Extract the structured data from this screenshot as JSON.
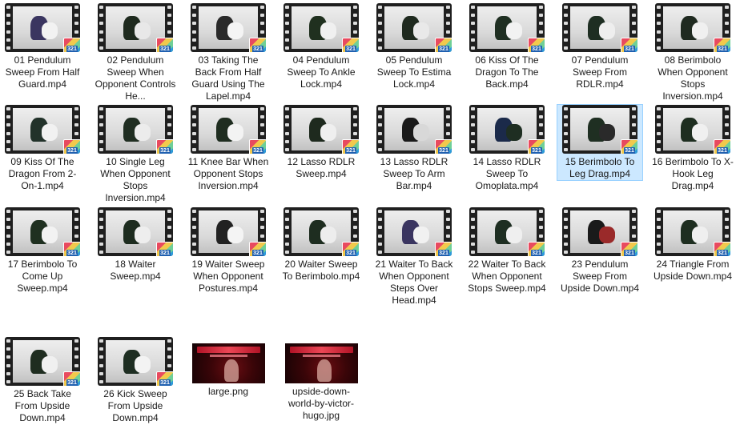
{
  "files": [
    {
      "name": "01 Pendulum Sweep From Half Guard.mp4",
      "type": "video",
      "tone": [
        "#3a3560",
        "#f2f2f2"
      ]
    },
    {
      "name": "02 Pendulum Sweep When Opponent Controls He...",
      "type": "video",
      "tone": [
        "#1e2a1e",
        "#e8e8e8"
      ]
    },
    {
      "name": "03 Taking The Back From Half Guard Using The Lapel.mp4",
      "type": "video",
      "tone": [
        "#2a2a2a",
        "#f4f4f4"
      ]
    },
    {
      "name": "04 Pendulum Sweep To Ankle Lock.mp4",
      "type": "video",
      "tone": [
        "#20301f",
        "#f0f0f0"
      ]
    },
    {
      "name": "05 Pendulum Sweep To Estima Lock.mp4",
      "type": "video",
      "tone": [
        "#1f2a1f",
        "#e9e9e9"
      ]
    },
    {
      "name": "06 Kiss Of The Dragon To The Back.mp4",
      "type": "video",
      "tone": [
        "#1f2f22",
        "#f2f2f2"
      ]
    },
    {
      "name": "07 Pendulum Sweep From RDLR.mp4",
      "type": "video",
      "tone": [
        "#1e2e22",
        "#eeeeee"
      ]
    },
    {
      "name": "08 Berimbolo When Opponent Stops Inversion.mp4",
      "type": "video",
      "tone": [
        "#1f2a20",
        "#f0f0f0"
      ]
    },
    {
      "name": "09 Kiss Of The Dragon From 2-On-1.mp4",
      "type": "video",
      "tone": [
        "#22322a",
        "#f1f1f1"
      ]
    },
    {
      "name": "10 Single Leg When Opponent Stops Inversion.mp4",
      "type": "video",
      "tone": [
        "#202e22",
        "#ececec"
      ]
    },
    {
      "name": "11 Knee Bar When Opponent Stops Inversion.mp4",
      "type": "video",
      "tone": [
        "#1f2d20",
        "#f3f3f3"
      ]
    },
    {
      "name": "12 Lasso RDLR Sweep.mp4",
      "type": "video",
      "tone": [
        "#1e2a1e",
        "#efefef"
      ]
    },
    {
      "name": "13 Lasso RDLR Sweep To Arm Bar.mp4",
      "type": "video",
      "tone": [
        "#1a1a1a",
        "#d8d8d8"
      ]
    },
    {
      "name": "14 Lasso RDLR Sweep To Omoplata.mp4",
      "type": "video",
      "tone": [
        "#1b2a4a",
        "#1e2e22"
      ]
    },
    {
      "name": "15 Berimbolo To Leg Drag.mp4",
      "type": "video",
      "tone": [
        "#1f2f22",
        "#2a2a2a"
      ],
      "selected": true
    },
    {
      "name": "16 Berimbolo To X-Hook Leg Drag.mp4",
      "type": "video",
      "tone": [
        "#1e2e20",
        "#f0f0f0"
      ]
    },
    {
      "name": "17 Berimbolo To Come Up Sweep.mp4",
      "type": "video",
      "tone": [
        "#1f3020",
        "#f2f2f2"
      ]
    },
    {
      "name": "18 Waiter Sweep.mp4",
      "type": "video",
      "tone": [
        "#1d2c1f",
        "#eeeeee"
      ]
    },
    {
      "name": "19 Waiter Sweep When Opponent Postures.mp4",
      "type": "video",
      "tone": [
        "#222222",
        "#f4f4f4"
      ]
    },
    {
      "name": "20 Waiter Sweep To Berimbolo.mp4",
      "type": "video",
      "tone": [
        "#1e2d20",
        "#ededed"
      ]
    },
    {
      "name": "21 Waiter To Back When Opponent Steps Over Head.mp4",
      "type": "video",
      "tone": [
        "#3a3560",
        "#f1f1f1"
      ]
    },
    {
      "name": "22 Waiter To Back When Opponent Stops Sweep.mp4",
      "type": "video",
      "tone": [
        "#1e2e22",
        "#efefef"
      ]
    },
    {
      "name": "23 Pendulum Sweep From Upside Down.mp4",
      "type": "video",
      "tone": [
        "#1a1a1a",
        "#9a2a2a"
      ]
    },
    {
      "name": "24 Triangle From Upside Down.mp4",
      "type": "video",
      "tone": [
        "#1e2e20",
        "#efefef"
      ]
    },
    {
      "name": "25 Back Take From Upside Down.mp4",
      "type": "video",
      "tone": [
        "#1f2d20",
        "#f0f0f0"
      ]
    },
    {
      "name": "26 Kick Sweep From Upside Down.mp4",
      "type": "video",
      "tone": [
        "#1e2e22",
        "#f3f3f3"
      ]
    },
    {
      "name": "large.png",
      "type": "image"
    },
    {
      "name": "upside-down-world-by-victor-hugo.jpg",
      "type": "image"
    }
  ],
  "badge_text": "321"
}
